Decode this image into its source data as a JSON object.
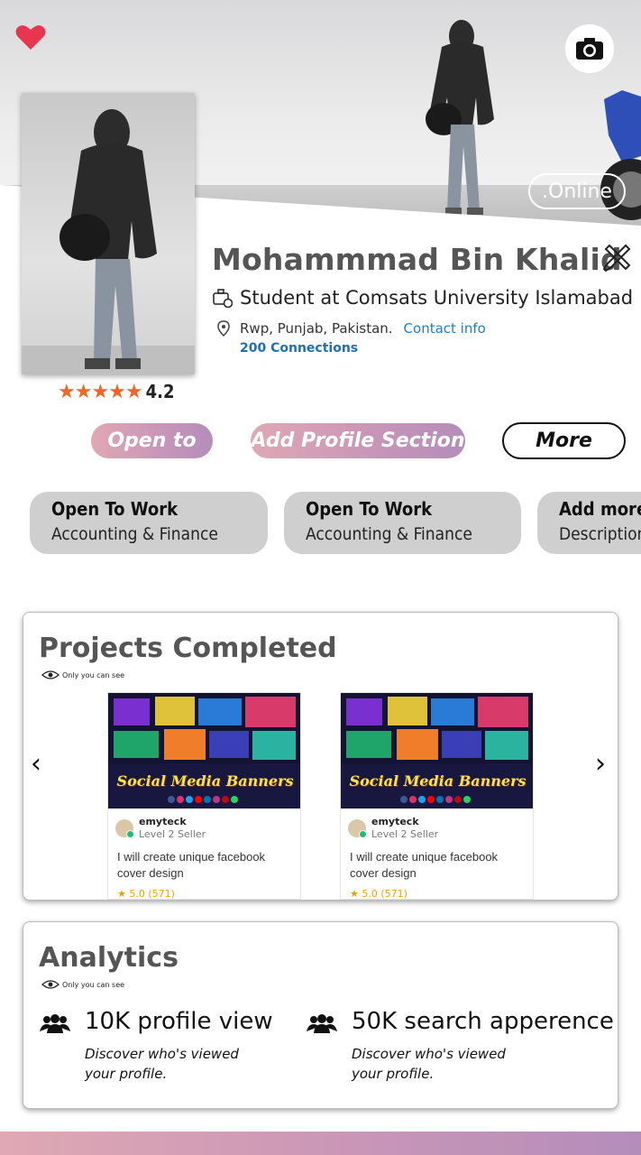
{
  "status": {
    "online": ".Online"
  },
  "profile": {
    "name": "Mohammmad Bin Khalid",
    "headline": "Student at Comsats University Islamabad",
    "location": "Rwp, Punjab, Pakistan.",
    "contact_link": "Contact info",
    "connections": "200 Connections",
    "rating": {
      "stars": "★★★★★",
      "value": "4.2"
    }
  },
  "actions": {
    "open_to": "Open to",
    "add_section": "Add Profile Section",
    "more": "More"
  },
  "open_to_work": [
    {
      "title": "Open To Work",
      "subtitle": "Accounting & Finance"
    },
    {
      "title": "Open To Work",
      "subtitle": "Accounting & Finance"
    },
    {
      "title": "Add more",
      "subtitle": "Description"
    }
  ],
  "projects": {
    "title": "Projects Completed",
    "visibility": "Only you can see",
    "gigs": [
      {
        "thumb_title": "Social Media Banners",
        "seller": "emyteck",
        "level": "Level 2 Seller",
        "description": "I will create unique facebook cover design",
        "rating": "★ 5.0 (571)"
      },
      {
        "thumb_title": "Social Media Banners",
        "seller": "emyteck",
        "level": "Level 2 Seller",
        "description": "I will create unique facebook cover design",
        "rating": "★ 5.0 (571)"
      }
    ],
    "prev": "‹",
    "next": "›"
  },
  "analytics": {
    "title": "Analytics",
    "visibility": "Only you can see",
    "stats": [
      {
        "value": "10K profile view",
        "description": "Discover who's viewed your profile."
      },
      {
        "value": "50K search apperence",
        "description": "Discover who's viewed your profile."
      }
    ]
  },
  "colors": {
    "accent_gradient": [
      "#e0a8b4",
      "#b48dbb"
    ],
    "heart": "#e8364f",
    "link": "#1f7fc4",
    "star": "#f26522"
  },
  "icons": {
    "favorite": "heart-icon",
    "camera": "camera-icon",
    "settings": "tools-icon",
    "work": "briefcase-icon",
    "location": "location-pin-icon",
    "visibility": "eye-icon",
    "people": "people-icon"
  }
}
